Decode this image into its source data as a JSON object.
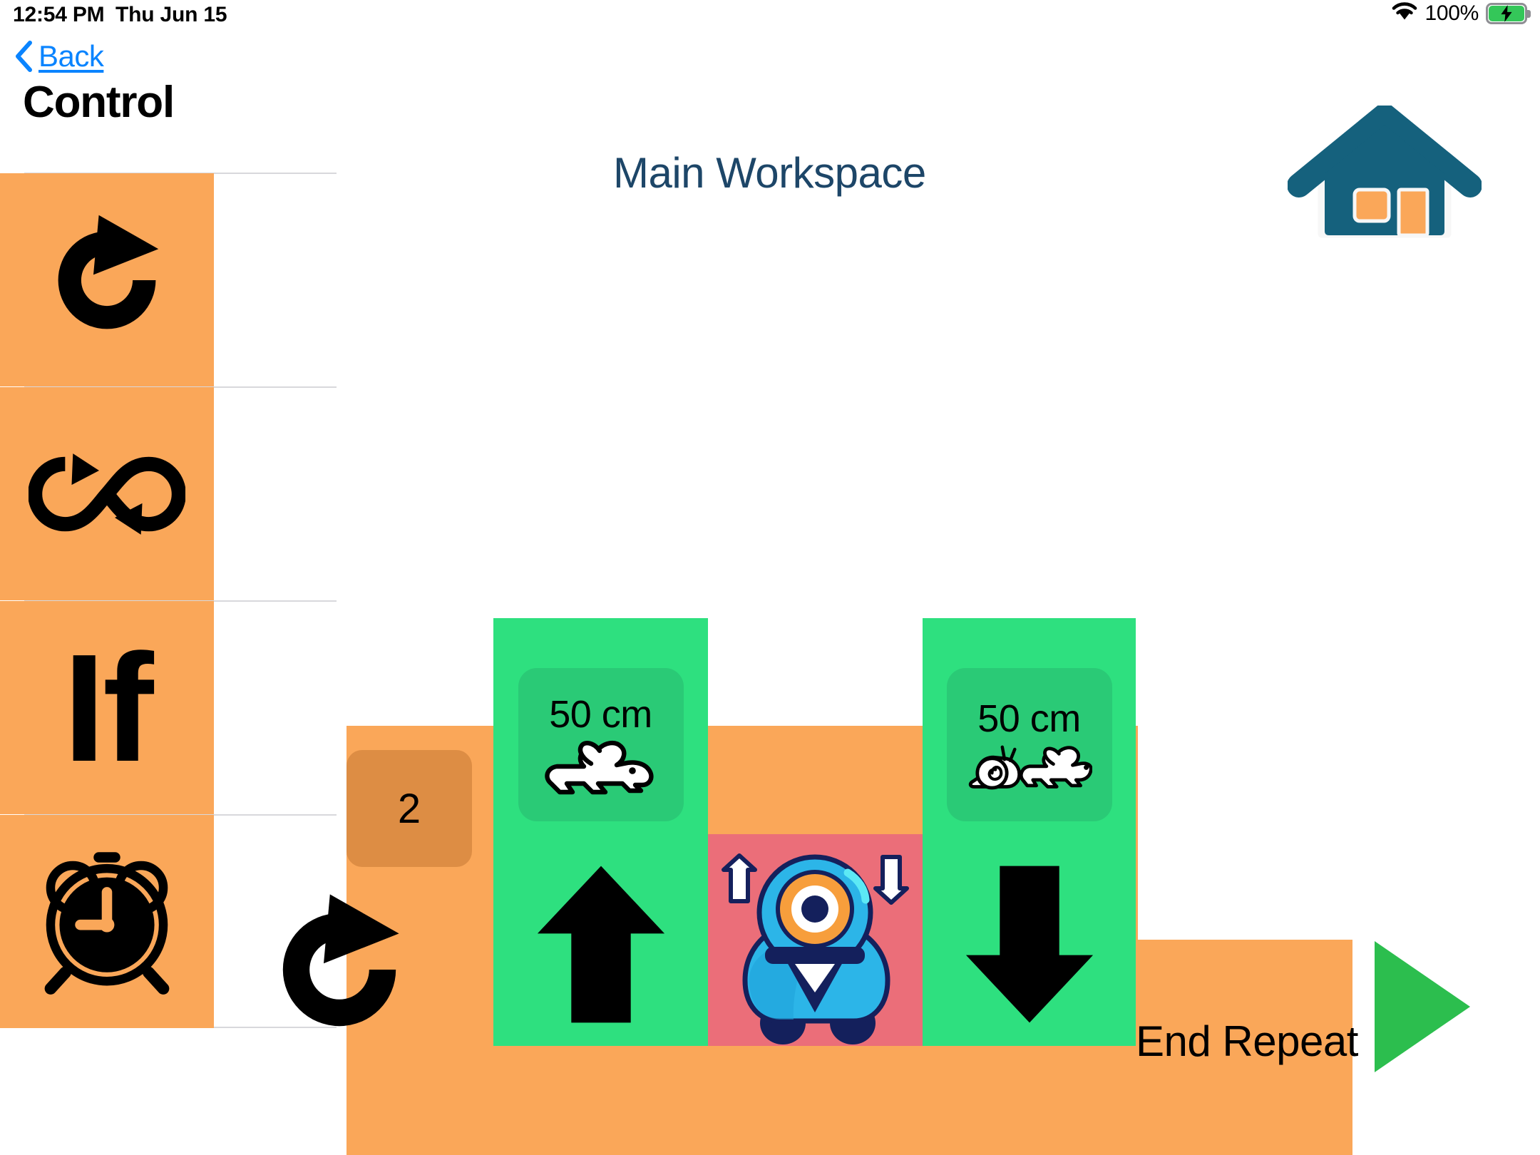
{
  "status_bar": {
    "time": "12:54 PM",
    "date": "Thu Jun 15",
    "battery_percent": "100%",
    "wifi_icon": "wifi-icon",
    "battery_icon": "battery-charging-icon"
  },
  "nav": {
    "back_label": "Back",
    "back_icon": "chevron-left-icon"
  },
  "sidebar": {
    "title": "Control",
    "items": [
      {
        "name": "repeat",
        "icon": "repeat-arrow-icon",
        "label": ""
      },
      {
        "name": "repeat-forever",
        "icon": "infinity-loop-icon",
        "label": ""
      },
      {
        "name": "if",
        "icon": "if-text-icon",
        "label": "If"
      },
      {
        "name": "wait",
        "icon": "alarm-clock-icon",
        "label": ""
      }
    ]
  },
  "workspace": {
    "title": "Main Workspace",
    "home_icon": "home-icon",
    "play_icon": "play-triangle-icon",
    "colors": {
      "control_orange": "#faa759",
      "control_orange_dark": "#dd8d44",
      "drive_green": "#2ee07f",
      "drive_green_dark": "#2aca76",
      "robot_pink": "#eb6e79",
      "play_green": "#2cbe4e",
      "title_navy": "#1d4668",
      "link_blue": "#0a84ff"
    },
    "blocks": [
      {
        "name": "repeat-block",
        "type": "repeat",
        "count": "2",
        "icon": "repeat-arrow-icon"
      },
      {
        "name": "drive-forward-block",
        "type": "drive",
        "distance": "50 cm",
        "speed_icons": "rabbit-icon",
        "direction_icon": "arrow-up-icon"
      },
      {
        "name": "robot-block",
        "type": "robot",
        "icon": "dash-robot-icon",
        "up_icon": "arrow-up-icon",
        "down_icon": "arrow-down-icon"
      },
      {
        "name": "drive-backward-block",
        "type": "drive",
        "distance": "50 cm",
        "speed_icons": "snail-rabbit-icon",
        "direction_icon": "arrow-down-icon"
      },
      {
        "name": "end-repeat-block",
        "type": "end-repeat",
        "label": "End Repeat"
      }
    ]
  }
}
